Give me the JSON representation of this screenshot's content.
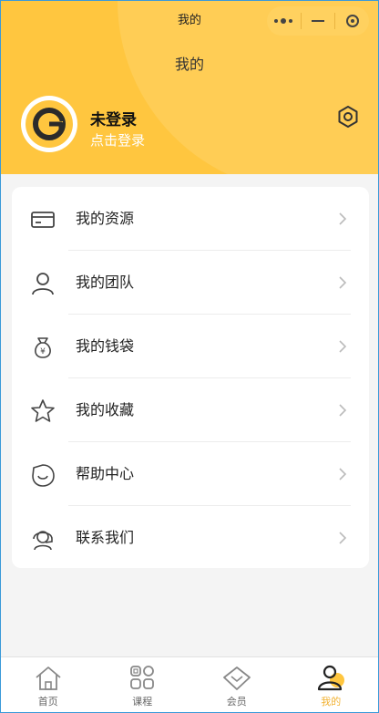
{
  "window": {
    "title": "我的"
  },
  "header": {
    "title": "我的"
  },
  "profile": {
    "name": "未登录",
    "login_link": "点击登录"
  },
  "menu": [
    {
      "label": "我的资源",
      "icon": "card-icon"
    },
    {
      "label": "我的团队",
      "icon": "person-icon"
    },
    {
      "label": "我的钱袋",
      "icon": "money-bag-icon"
    },
    {
      "label": "我的收藏",
      "icon": "star-icon"
    },
    {
      "label": "帮助中心",
      "icon": "smile-icon"
    },
    {
      "label": "联系我们",
      "icon": "headset-icon"
    }
  ],
  "tabbar": {
    "items": [
      {
        "label": "首页",
        "icon": "home-icon"
      },
      {
        "label": "课程",
        "icon": "grid-icon"
      },
      {
        "label": "会员",
        "icon": "diamond-icon"
      },
      {
        "label": "我的",
        "icon": "user-icon",
        "active": true
      }
    ]
  },
  "colors": {
    "accent": "#ffc63f",
    "active_tab": "#f2b233"
  }
}
